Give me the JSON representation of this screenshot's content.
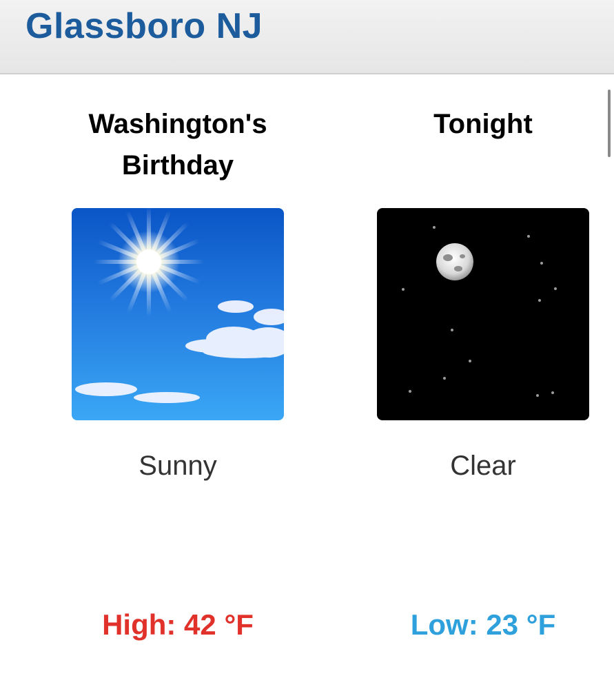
{
  "header": {
    "location": "Glassboro NJ"
  },
  "forecast": [
    {
      "period_name": "Washington's Birthday",
      "icon": "sunny-sky-icon",
      "short_desc": "Sunny",
      "temp": "High: 42 °F",
      "temp_color": "#e0322a"
    },
    {
      "period_name": "Tonight",
      "icon": "clear-night-moon-icon",
      "short_desc": "Clear",
      "temp": "Low: 23 °F",
      "temp_color": "#2ea1dc"
    }
  ],
  "colors": {
    "title": "#1c5c9c",
    "high": "#e0322a",
    "low": "#2ea1dc"
  }
}
